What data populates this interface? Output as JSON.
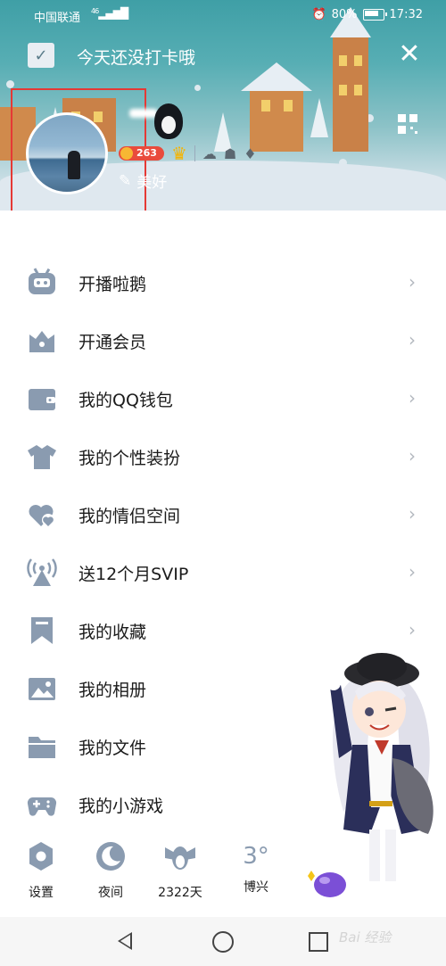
{
  "status_bar": {
    "carrier": "中国联通",
    "network": "46",
    "battery": "80%",
    "time": "17:32"
  },
  "header": {
    "checkin_text": "今天还没打卡哦",
    "level_value": "263",
    "signature": "美好"
  },
  "menu": {
    "items": [
      {
        "label": "开播啦鹅",
        "icon": "live-tv-icon",
        "has_arrow": true
      },
      {
        "label": "开通会员",
        "icon": "vip-crown-icon",
        "has_arrow": true
      },
      {
        "label": "我的QQ钱包",
        "icon": "wallet-icon",
        "has_arrow": true
      },
      {
        "label": "我的个性装扮",
        "icon": "tshirt-icon",
        "has_arrow": true
      },
      {
        "label": "我的情侣空间",
        "icon": "hearts-icon",
        "has_arrow": true
      },
      {
        "label": "送12个月SVIP",
        "icon": "broadcast-tower-icon",
        "has_arrow": true
      },
      {
        "label": "我的收藏",
        "icon": "bookmark-icon",
        "has_arrow": true
      },
      {
        "label": "我的相册",
        "icon": "photo-icon",
        "has_arrow": false
      },
      {
        "label": "我的文件",
        "icon": "folder-icon",
        "has_arrow": false
      },
      {
        "label": "我的小游戏",
        "icon": "gamepad-icon",
        "has_arrow": false
      }
    ]
  },
  "shortcuts": {
    "settings": "设置",
    "night": "夜间",
    "days": "2322天",
    "temperature": "3°",
    "city": "博兴"
  },
  "watermark": "Bai 经验",
  "colors": {
    "icon": "#8a9bb0",
    "header_top": "#3f9fa6",
    "highlight_frame": "#e53935",
    "level_badge": "#e94b3c"
  }
}
